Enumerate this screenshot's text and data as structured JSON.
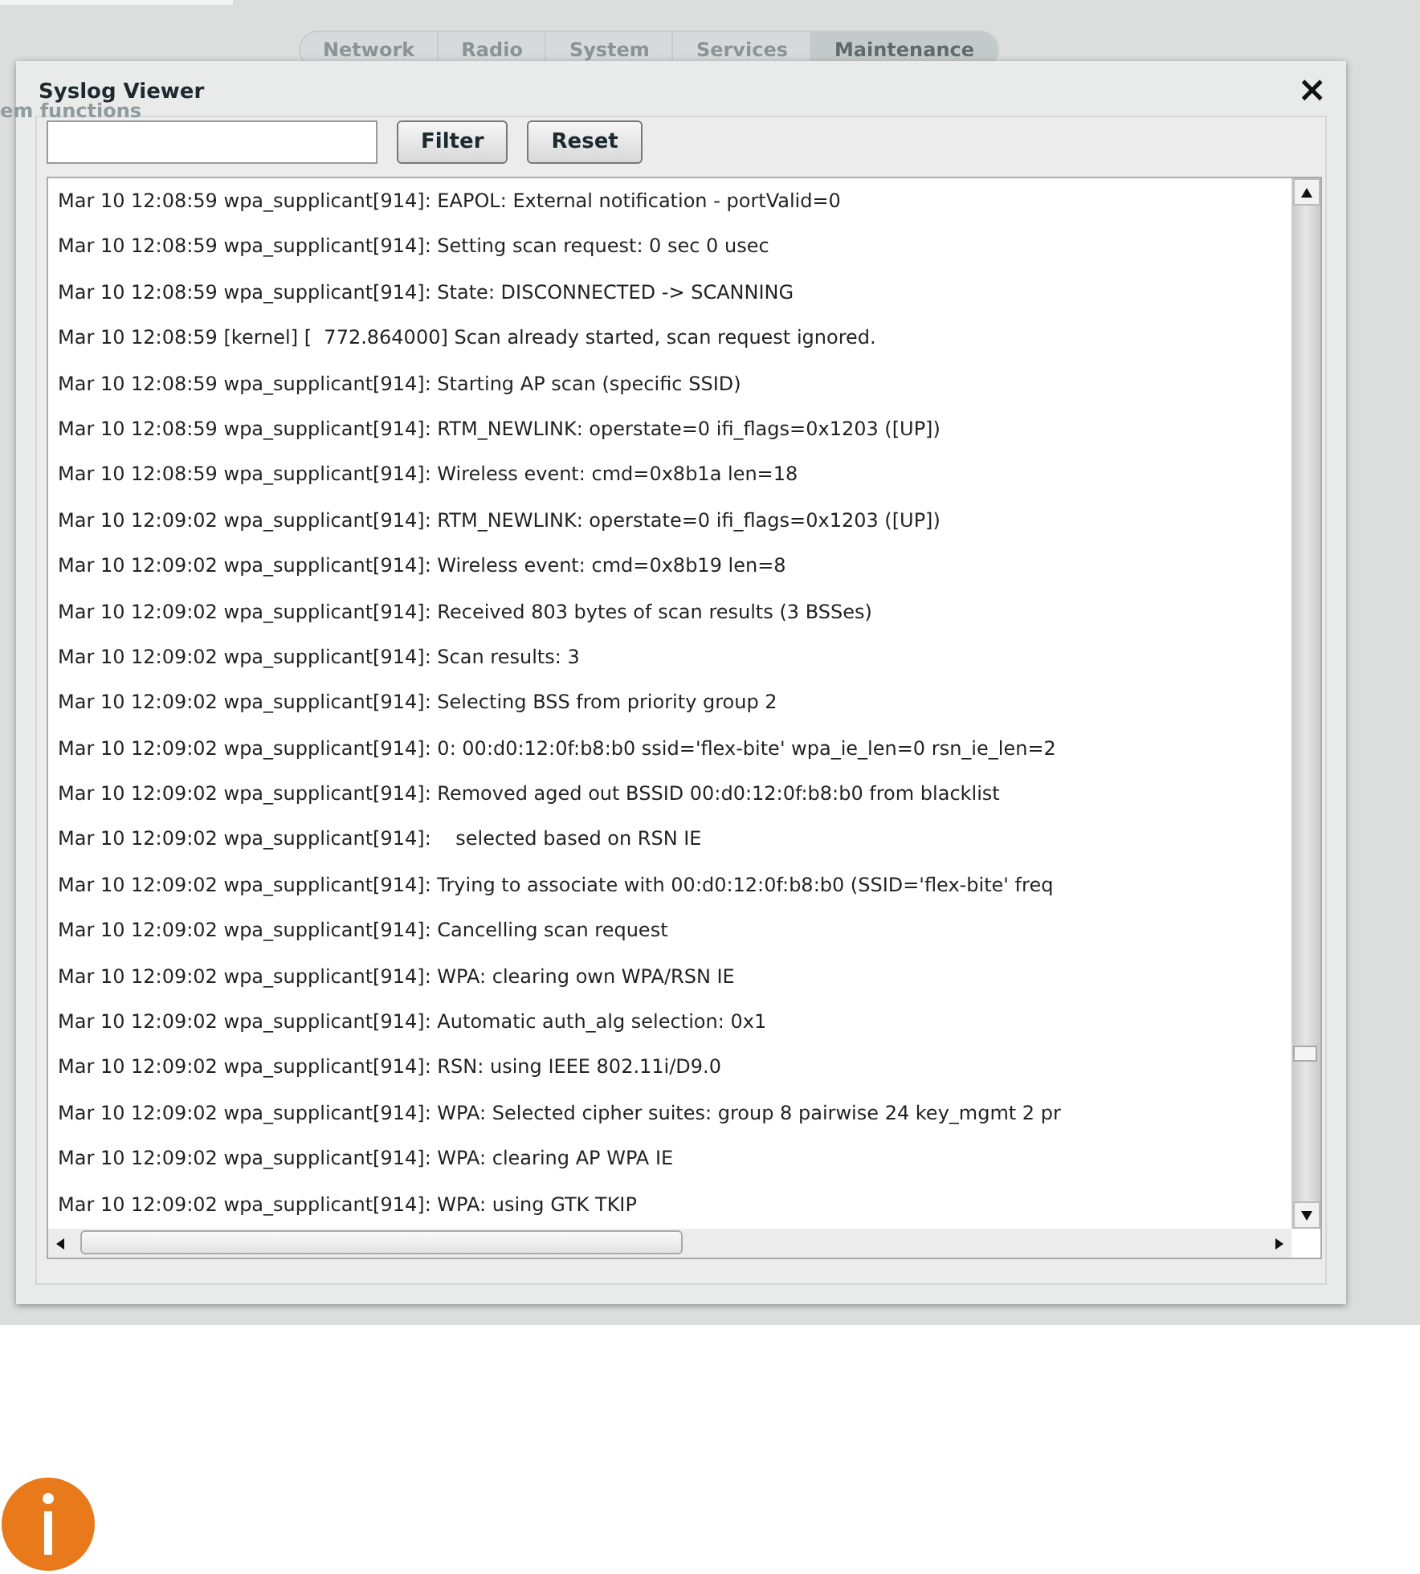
{
  "nav_tabs": [
    {
      "label": "Network",
      "selected": false
    },
    {
      "label": "Radio",
      "selected": false
    },
    {
      "label": "System",
      "selected": false
    },
    {
      "label": "Services",
      "selected": false
    },
    {
      "label": "Maintenance",
      "selected": true
    }
  ],
  "background_heading": "em functions",
  "dialog": {
    "title": "Syslog Viewer",
    "close": "×",
    "buttons": [
      "Filter",
      "Reset"
    ],
    "log_lines": [
      "Mar 10 12:08:59 wpa_supplicant[914]: EAPOL: External notification - portValid=0",
      "Mar 10 12:08:59 wpa_supplicant[914]: Setting scan request: 0 sec 0 usec",
      "Mar 10 12:08:59 wpa_supplicant[914]: State: DISCONNECTED -> SCANNING",
      "Mar 10 12:08:59 [kernel] [  772.864000] Scan already started, scan request ignored.",
      "Mar 10 12:08:59 wpa_supplicant[914]: Starting AP scan (specific SSID)",
      "Mar 10 12:08:59 wpa_supplicant[914]: RTM_NEWLINK: operstate=0 ifi_flags=0x1203 ([UP])",
      "Mar 10 12:08:59 wpa_supplicant[914]: Wireless event: cmd=0x8b1a len=18",
      "Mar 10 12:09:02 wpa_supplicant[914]: RTM_NEWLINK: operstate=0 ifi_flags=0x1203 ([UP])",
      "Mar 10 12:09:02 wpa_supplicant[914]: Wireless event: cmd=0x8b19 len=8",
      "Mar 10 12:09:02 wpa_supplicant[914]: Received 803 bytes of scan results (3 BSSes)",
      "Mar 10 12:09:02 wpa_supplicant[914]: Scan results: 3",
      "Mar 10 12:09:02 wpa_supplicant[914]: Selecting BSS from priority group 2",
      "Mar 10 12:09:02 wpa_supplicant[914]: 0: 00:d0:12:0f:b8:b0 ssid='flex-bite' wpa_ie_len=0 rsn_ie_len=2",
      "Mar 10 12:09:02 wpa_supplicant[914]: Removed aged out BSSID 00:d0:12:0f:b8:b0 from blacklist",
      "Mar 10 12:09:02 wpa_supplicant[914]:    selected based on RSN IE",
      "Mar 10 12:09:02 wpa_supplicant[914]: Trying to associate with 00:d0:12:0f:b8:b0 (SSID='flex-bite' freq",
      "Mar 10 12:09:02 wpa_supplicant[914]: Cancelling scan request",
      "Mar 10 12:09:02 wpa_supplicant[914]: WPA: clearing own WPA/RSN IE",
      "Mar 10 12:09:02 wpa_supplicant[914]: Automatic auth_alg selection: 0x1",
      "Mar 10 12:09:02 wpa_supplicant[914]: RSN: using IEEE 802.11i/D9.0",
      "Mar 10 12:09:02 wpa_supplicant[914]: WPA: Selected cipher suites: group 8 pairwise 24 key_mgmt 2 pr",
      "Mar 10 12:09:02 wpa_supplicant[914]: WPA: clearing AP WPA IE",
      "Mar 10 12:09:02 wpa_supplicant[914]: WPA: using GTK TKIP"
    ]
  }
}
